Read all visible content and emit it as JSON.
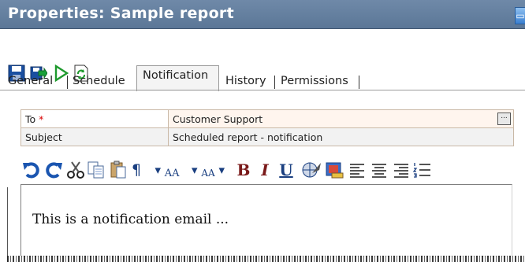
{
  "window": {
    "title": "Properties: Sample report",
    "maximize_glyph": "▭"
  },
  "toolbar": {
    "buttons": [
      {
        "icon": "save-icon"
      },
      {
        "icon": "save-and-close-icon"
      },
      {
        "icon": "run-icon"
      },
      {
        "icon": "refresh-icon"
      }
    ]
  },
  "tabs": [
    {
      "label": "General"
    },
    {
      "label": "Schedule"
    },
    {
      "label": "Notification",
      "active": true
    },
    {
      "label": "History"
    },
    {
      "label": "Permissions"
    }
  ],
  "fields": {
    "to_label": "To",
    "to_required_mark": "*",
    "to_value": "Customer Support",
    "browse_label": "...",
    "subject_label": "Subject",
    "subject_value": "Scheduled report - notification"
  },
  "editor_toolbar": {
    "paragraph_glyph": "¶",
    "font_grow_glyph": "AA",
    "font_shrink_glyph": "AA",
    "bold_glyph": "B",
    "italic_glyph": "I",
    "underline_glyph": "U",
    "dropdown_glyph": "▾"
  },
  "editor": {
    "body_text": "This is a notification email ..."
  },
  "colors": {
    "titlebar": "#5b7797",
    "accent_blue": "#1a4fa0",
    "required": "#d80000",
    "field_value_bg": "#fff5ee"
  }
}
